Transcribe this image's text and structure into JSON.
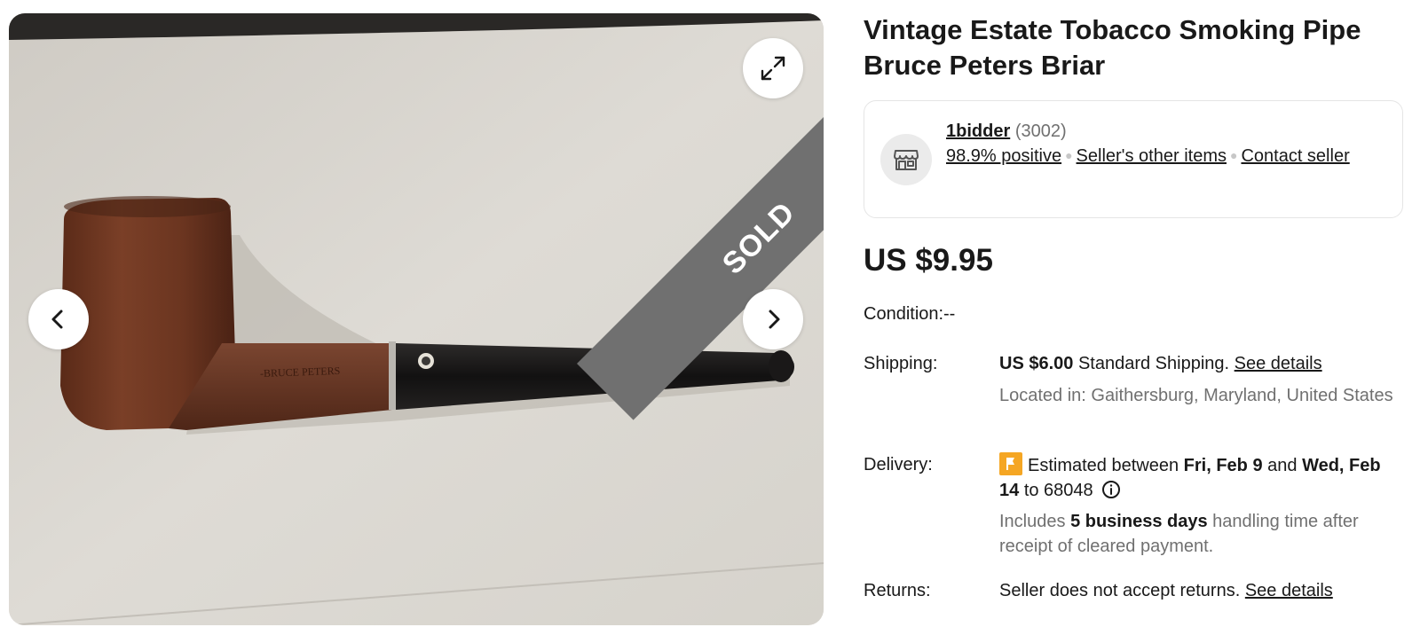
{
  "gallery": {
    "image_subject": "estate briar tobacco pipe",
    "stamp_text": "BRUCE PETERS",
    "sold_label": "SOLD",
    "expand_icon": "expand-icon",
    "prev_icon": "chevron-left-icon",
    "next_icon": "chevron-right-icon"
  },
  "listing": {
    "title": "Vintage Estate Tobacco Smoking Pipe Bruce Peters Briar",
    "price": "US $9.95"
  },
  "seller": {
    "icon": "store-icon",
    "name": "1bidder",
    "feedback_count": "(3002)",
    "positive": "98.9% positive",
    "other_items": "Seller's other items",
    "contact": "Contact seller"
  },
  "details": {
    "condition_label": "Condition:",
    "condition_value": "--",
    "shipping_label": "Shipping:",
    "shipping_price": "US $6.00",
    "shipping_method": "Standard Shipping.",
    "shipping_link": "See details",
    "location": "Located in: Gaithersburg, Maryland, United States",
    "delivery_label": "Delivery:",
    "delivery_prefix": "Estimated between",
    "delivery_start": "Fri, Feb 9",
    "delivery_and": "and",
    "delivery_end": "Wed, Feb 14",
    "delivery_to": "to 68048",
    "handling_prefix": "Includes",
    "handling_days": "5 business days",
    "handling_suffix": "handling time after receipt of cleared payment.",
    "returns_label": "Returns:",
    "returns_text": "Seller does not accept returns.",
    "returns_link": "See details"
  },
  "colors": {
    "text": "#191919",
    "muted": "#707070",
    "flag": "#f5a623",
    "sold_band": "#707070"
  }
}
